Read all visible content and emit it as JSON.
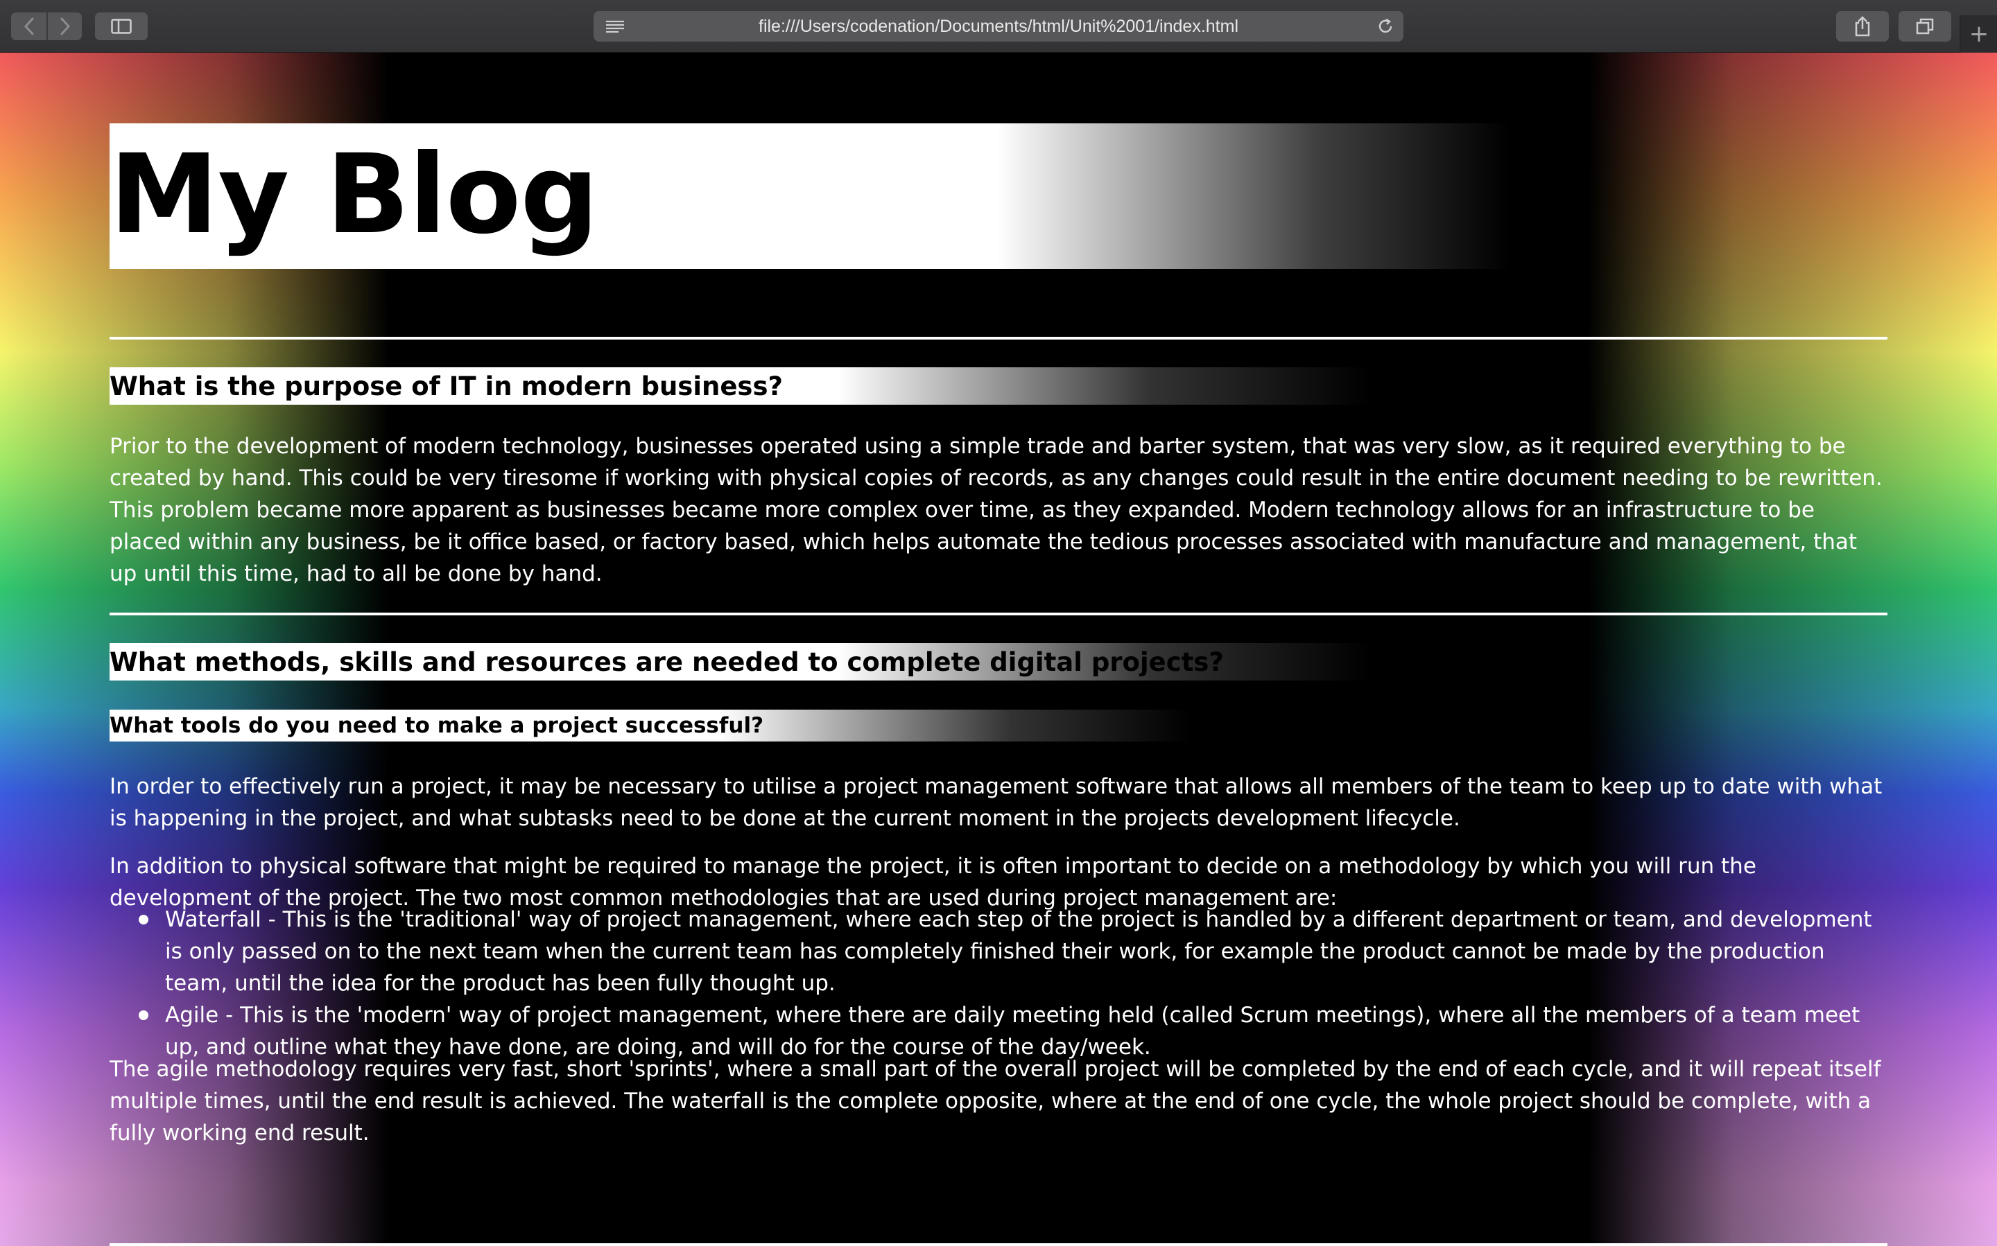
{
  "browser": {
    "url": "file:///Users/codenation/Documents/html/Unit%2001/index.html",
    "back_icon": "chevron-left-icon",
    "forward_icon": "chevron-right-icon",
    "new_tab_label": "+"
  },
  "page": {
    "title": "My Blog",
    "sections": [
      {
        "heading": "What is the purpose of IT in modern business?",
        "paragraph": "Prior to the development of modern technology, businesses operated using a simple trade and barter system, that was very slow, as it required everything to be created by hand. This could be very tiresome if working with physical copies of records, as any changes could result in the entire document needing to be rewritten. This problem became more apparent as businesses became more complex over time, as they expanded. Modern technology allows for an infrastructure to be placed within any business, be it office based, or factory based, which helps automate the tedious processes associated with manufacture and management, that up until this time, had to all be done by hand."
      },
      {
        "heading": "What methods, skills and resources are needed to complete digital projects?",
        "subheading": "What tools do you need to make a project successful?",
        "paragraph_1": "In order to effectively run a project, it may be necessary to utilise a project management software that allows all members of the team to keep up to date with what is happening in the project, and what subtasks need to be done at the current moment in the projects development lifecycle.",
        "paragraph_2": "In addition to physical software that might be required to manage the project, it is often important to decide on a methodology by which you will run the development of the project. The two most common methodologies that are used during project management are:",
        "list": [
          "Waterfall - This is the 'traditional' way of project management, where each step of the project is handled by a different department or team, and development is only passed on to the next team when the current team has completely finished their work, for example the product cannot be made by the production team, until the idea for the product has been fully thought up.",
          "Agile - This is the 'modern' way of project management, where there are daily meeting held (called Scrum meetings), where all the members of a team meet up, and outline what they have done, are doing, and will do for the course of the day/week."
        ],
        "paragraph_3": "The agile methodology requires very fast, short 'sprints', where a small part of the overall project will be completed by the end of each cycle, and it will repeat itself multiple times, until the end result is achieved. The waterfall is the complete opposite, where at the end of one cycle, the whole project should be complete, with a fully working end result."
      }
    ]
  }
}
